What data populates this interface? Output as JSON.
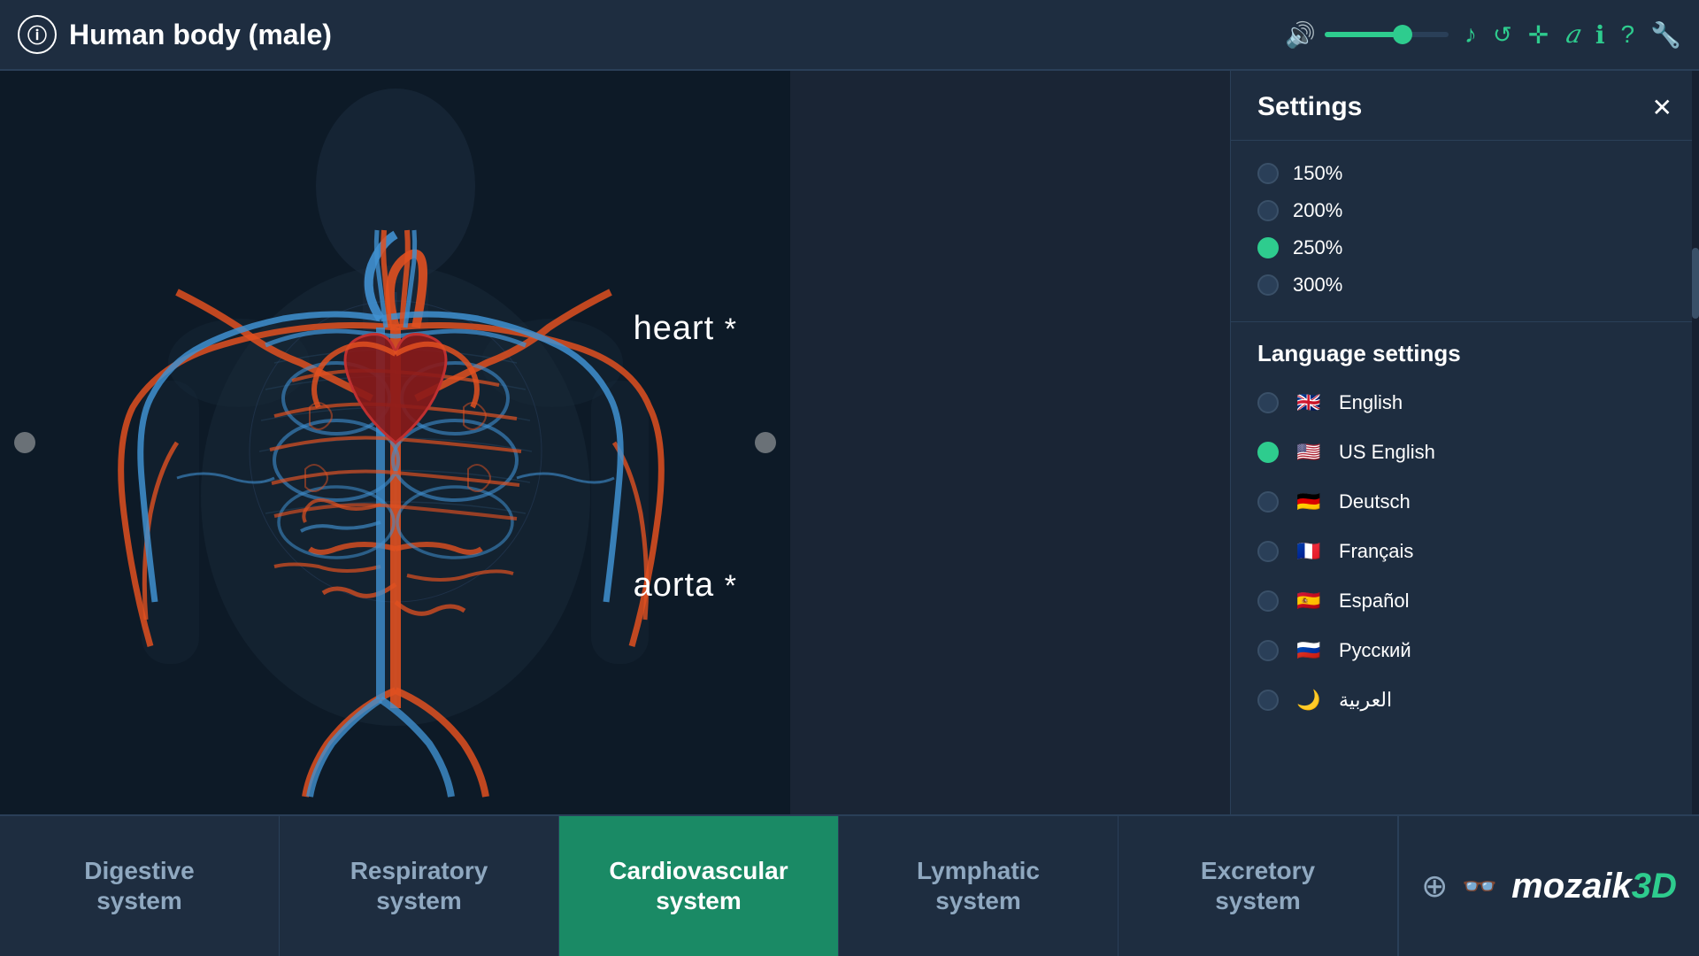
{
  "header": {
    "info_icon": "ⓘ",
    "title": "Human body (male)",
    "volume_icon": "🔊",
    "music_icon": "♪",
    "rotate_icon": "↺",
    "move_icon": "✛",
    "font_icon": "𝑎",
    "info2_icon": "ℹ",
    "help_icon": "?",
    "settings_icon": "🔧"
  },
  "settings": {
    "title": "Settings",
    "close_label": "✕",
    "zoom_options": [
      {
        "label": "150%",
        "active": false
      },
      {
        "label": "200%",
        "active": false
      },
      {
        "label": "250%",
        "active": true
      },
      {
        "label": "300%",
        "active": false
      }
    ],
    "language_section_title": "Language settings",
    "languages": [
      {
        "label": "English",
        "flag": "🇬🇧",
        "active": false
      },
      {
        "label": "US English",
        "flag": "🇺🇸",
        "active": true
      },
      {
        "label": "Deutsch",
        "flag": "🇩🇪",
        "active": false
      },
      {
        "label": "Français",
        "flag": "🇫🇷",
        "active": false
      },
      {
        "label": "Español",
        "flag": "🇪🇸",
        "active": false
      },
      {
        "label": "Русский",
        "flag": "🇷🇺",
        "active": false
      },
      {
        "label": "العربية",
        "flag": "🌙",
        "active": false
      }
    ]
  },
  "viewport": {
    "labels": [
      {
        "id": "heart",
        "text": "heart",
        "suffix": "*"
      },
      {
        "id": "aorta",
        "text": "aorta",
        "suffix": "*"
      }
    ]
  },
  "tabs": [
    {
      "id": "digestive",
      "label": "Digestive\nsystem",
      "active": false
    },
    {
      "id": "respiratory",
      "label": "Respiratory\nsystem",
      "active": false
    },
    {
      "id": "cardiovascular",
      "label": "Cardiovascular\nsystem",
      "active": true
    },
    {
      "id": "lymphatic",
      "label": "Lymphatic\nsystem",
      "active": false
    },
    {
      "id": "excretory",
      "label": "Excretory\nsystem",
      "active": false
    }
  ],
  "branding": {
    "layers_icon": "⊕",
    "vr_icon": "👓",
    "logo_text": "mozaik",
    "logo_suffix": "3D"
  }
}
